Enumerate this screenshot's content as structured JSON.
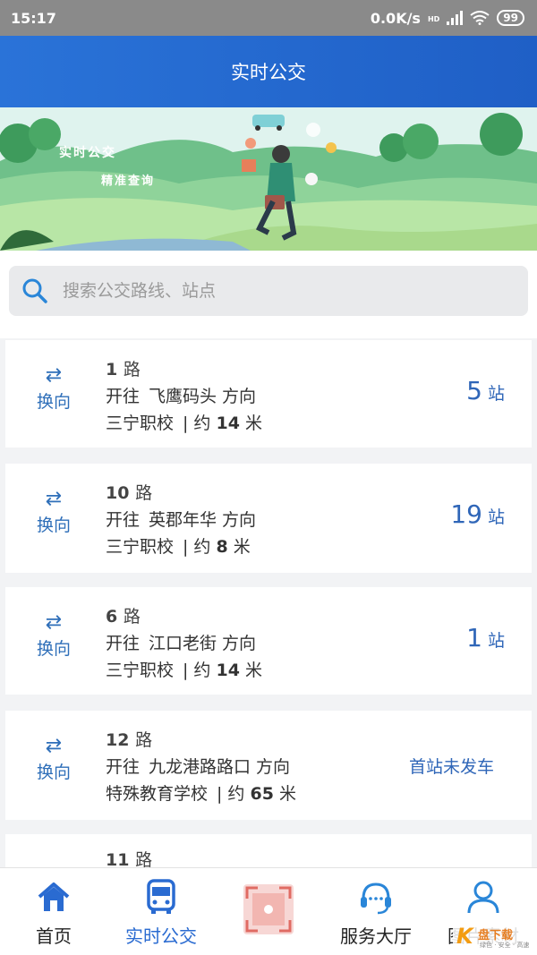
{
  "status_bar": {
    "time": "15:17",
    "speed": "0.0K/s",
    "network_label": "HD",
    "battery": "99"
  },
  "header": {
    "title": "实时公交"
  },
  "banner": {
    "line1": "实时公交",
    "line2": "精准查询"
  },
  "search": {
    "placeholder": "搜索公交路线、站点"
  },
  "routes": [
    {
      "name_num": "1",
      "name_suffix": "路",
      "dir_prefix": "开往",
      "destination": "飞鹰码头",
      "dir_suffix": "方向",
      "stop": "三宁职校",
      "distance_prefix": "约",
      "distance": "14",
      "distance_unit": "米",
      "swap_label": "换向",
      "status_num": "5",
      "status_unit": "站"
    },
    {
      "name_num": "10",
      "name_suffix": "路",
      "dir_prefix": "开往",
      "destination": "英郡年华",
      "dir_suffix": "方向",
      "stop": "三宁职校",
      "distance_prefix": "约",
      "distance": "8",
      "distance_unit": "米",
      "swap_label": "换向",
      "status_num": "19",
      "status_unit": "站"
    },
    {
      "name_num": "6",
      "name_suffix": "路",
      "dir_prefix": "开往",
      "destination": "江口老街",
      "dir_suffix": "方向",
      "stop": "三宁职校",
      "distance_prefix": "约",
      "distance": "14",
      "distance_unit": "米",
      "swap_label": "换向",
      "status_num": "1",
      "status_unit": "站"
    },
    {
      "name_num": "12",
      "name_suffix": "路",
      "dir_prefix": "开往",
      "destination": "九龙港路路口",
      "dir_suffix": "方向",
      "stop": "特殊教育学校",
      "distance_prefix": "约",
      "distance": "65",
      "distance_unit": "米",
      "swap_label": "换向",
      "status_text": "首站未发车"
    },
    {
      "name_num": "11",
      "name_suffix": "路"
    }
  ],
  "tabs": [
    {
      "label": "首页",
      "icon": "home-icon"
    },
    {
      "label": "实时公交",
      "icon": "bus-icon"
    },
    {
      "label": "",
      "icon": "scan-icon"
    },
    {
      "label": "服务大厅",
      "icon": "headset-icon"
    },
    {
      "label": "图片素材",
      "icon": "user-icon"
    }
  ],
  "watermark": {
    "brand": "盘下载",
    "slogan": "绿色 · 安全 · 高速"
  },
  "colors": {
    "primary": "#2a6bd1",
    "header": "#2a73d8",
    "text_blue": "#2f66b8"
  }
}
